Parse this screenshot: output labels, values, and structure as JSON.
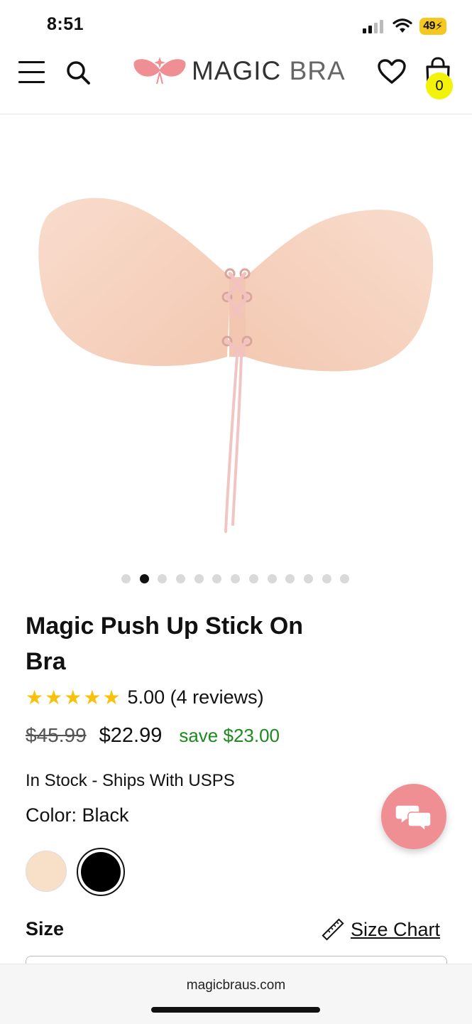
{
  "status_bar": {
    "time": "8:51",
    "battery": "49"
  },
  "header": {
    "brand_primary": "MAGIC",
    "brand_secondary": "BRA",
    "cart_count": "0"
  },
  "carousel": {
    "count": 13,
    "active_index": 1
  },
  "product": {
    "title": "Magic Push Up Stick On Bra",
    "rating_value": 5.0,
    "rating_text": "5.00 (4 reviews)",
    "original_price": "$45.99",
    "sale_price": "$22.99",
    "savings": "save $23.00",
    "stock": "In Stock - Ships With USPS",
    "color_label": "Color: Black",
    "swatches": [
      {
        "name": "nude",
        "color": "#f8dfc8",
        "selected": false
      },
      {
        "name": "black",
        "color": "#000000",
        "selected": true
      }
    ],
    "size_label": "Size",
    "size_chart": "Size Chart"
  },
  "browser": {
    "url": "magicbraus.com"
  },
  "colors": {
    "brand_pink": "#ef8f94",
    "star": "#f6c20c",
    "save_green": "#1d8a1d",
    "cart_badge": "#f2f20a"
  }
}
